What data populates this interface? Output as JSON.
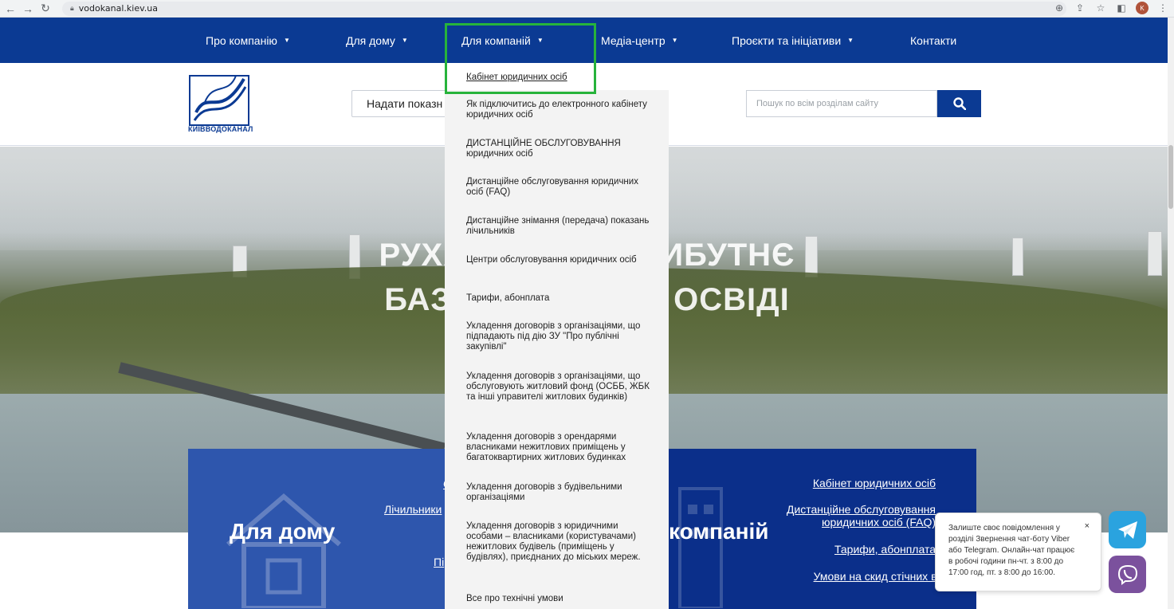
{
  "browser": {
    "url": "vodokanal.kiev.ua",
    "back_icon": "arrow-left-icon",
    "forward_icon": "arrow-right-icon",
    "reload_icon": "reload-icon",
    "profile_initial": "K"
  },
  "nav": {
    "items": [
      {
        "label": "Про компанію",
        "has_caret": true
      },
      {
        "label": "Для дому",
        "has_caret": true
      },
      {
        "label": "Для компаній",
        "has_caret": true
      },
      {
        "label": "Медіа-центр",
        "has_caret": true
      },
      {
        "label": "Проєкти та ініціативи",
        "has_caret": true
      },
      {
        "label": "Контакти",
        "has_caret": false
      }
    ],
    "caret": "▼",
    "color": "#0b3a93",
    "highlight_color": "#27b33b"
  },
  "header": {
    "logo_text": "КИЇВВОДОКАНАЛ",
    "meter_button": "Надати показн",
    "search_placeholder": "Пошук по всім розділам сайту"
  },
  "hero": {
    "line1": "РУХА                    ИБУТНЄ",
    "line2": "БАЗ                       ОСВІДІ"
  },
  "dropdown": {
    "items": [
      "Кабінет юридичних осіб",
      "Як підключитись до електронного кабінету юридичних осіб",
      "ДИСТАНЦІЙНЕ ОБСЛУГОВУВАННЯ юридичних осіб",
      "Дистанційне обслуговування юридичних осіб (FAQ)",
      "Дистанційне знімання (передача) показань лічильників",
      "Центри обслуговування юридичних осіб",
      "Тарифи, абонплата",
      "Укладення договорів з організаціями, що підпадають під дію ЗУ \"Про публічні закупівлі\"",
      "Укладення договорів з організаціями, що обслуговують житловий фонд (ОСББ, ЖБК та інші управителі житлових будинків)",
      "Укладення договорів з орендарями власниками нежитлових приміщень у багатоквартирних житлових будинках",
      "Укладення договорів з будівельними організаціями",
      "Укладення договорів з юридичними особами – власниками (користувачами) нежитлових будівель (приміщень у будівлях), приєднаних до міських мереж.",
      "Все про технічні умови"
    ]
  },
  "panels": {
    "home": {
      "title": "Для дому",
      "links": [
        "С",
        "Лічильники",
        "Пі"
      ]
    },
    "business": {
      "title": "компаній",
      "links": [
        "Кабінет юридичних осіб",
        "Дистанційне обслуговування юридичних осіб (FAQ)",
        "Тарифи, абонплата",
        "Умови на скид стічних вод"
      ]
    }
  },
  "chat": {
    "message": "Залиште своє повідомлення у розділі Звернення чат-боту Viber або Telegram. Онлайн-чат працює в робочі години пн-чт. з 8:00 до 17:00 год, пт. з 8:00 до 16:00.",
    "close": "×",
    "telegram_icon": "telegram-icon",
    "viber_icon": "viber-icon"
  }
}
